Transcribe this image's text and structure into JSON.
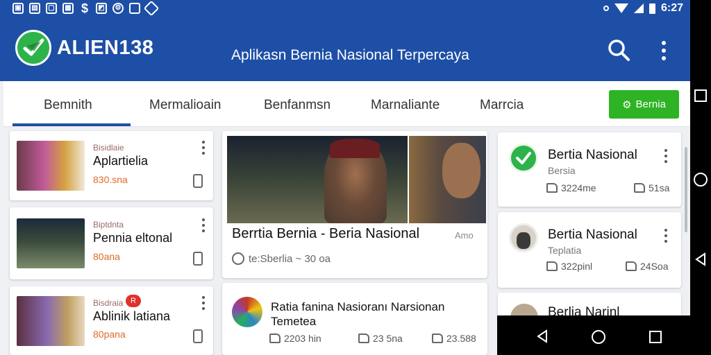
{
  "status_bar": {
    "left_icons": [
      "photo-icon",
      "message-icon",
      "image-icon",
      "calendar-icon",
      "dollar-icon",
      "gallery-icon",
      "settings-icon",
      "square-icon",
      "tag-icon"
    ],
    "time": "6:27"
  },
  "app_bar": {
    "brand": "ALIEN138",
    "tagline": "Aplikasn Bernia Nasional Terpercaya",
    "colors": {
      "primary": "#1e4fa6",
      "accent_green": "#2db324"
    }
  },
  "tabs": {
    "items": [
      "Bemnith",
      "Mermalioain",
      "Benfanmsn",
      "Marnaliante",
      "Marrcia"
    ],
    "active_index": 0,
    "cta_label": "Bernia"
  },
  "left_cards": [
    {
      "category": "Bisidlaie",
      "title": "Aplartielia",
      "meta": "830.sna"
    },
    {
      "category": "Biptdnta",
      "title": "Pennia eltonal",
      "meta": "80ana"
    },
    {
      "category": "Bisdraia",
      "badge": "R",
      "title": "Ablinik latiana",
      "meta": "80pana"
    }
  ],
  "hero": {
    "title": "Berrtia  Bernia - Beria Nasional",
    "more": "Amo",
    "meta": "te:Sberlia ~ 30 oa"
  },
  "story": {
    "title": "Ratia fanina Nasioranı Narsionan Temetea",
    "stats": [
      "2203 hin",
      "23 5na",
      "23.588"
    ]
  },
  "right_cards": [
    {
      "title": "Bertia Nasional",
      "subtitle": "Bersia",
      "stat_left": "3224me",
      "stat_right": "51sa"
    },
    {
      "title": "Bertia Nasional",
      "subtitle": "Teplatia",
      "stat_left": "322pinl",
      "stat_right": "24Soa"
    },
    {
      "title": "Berlia Narinl"
    }
  ]
}
